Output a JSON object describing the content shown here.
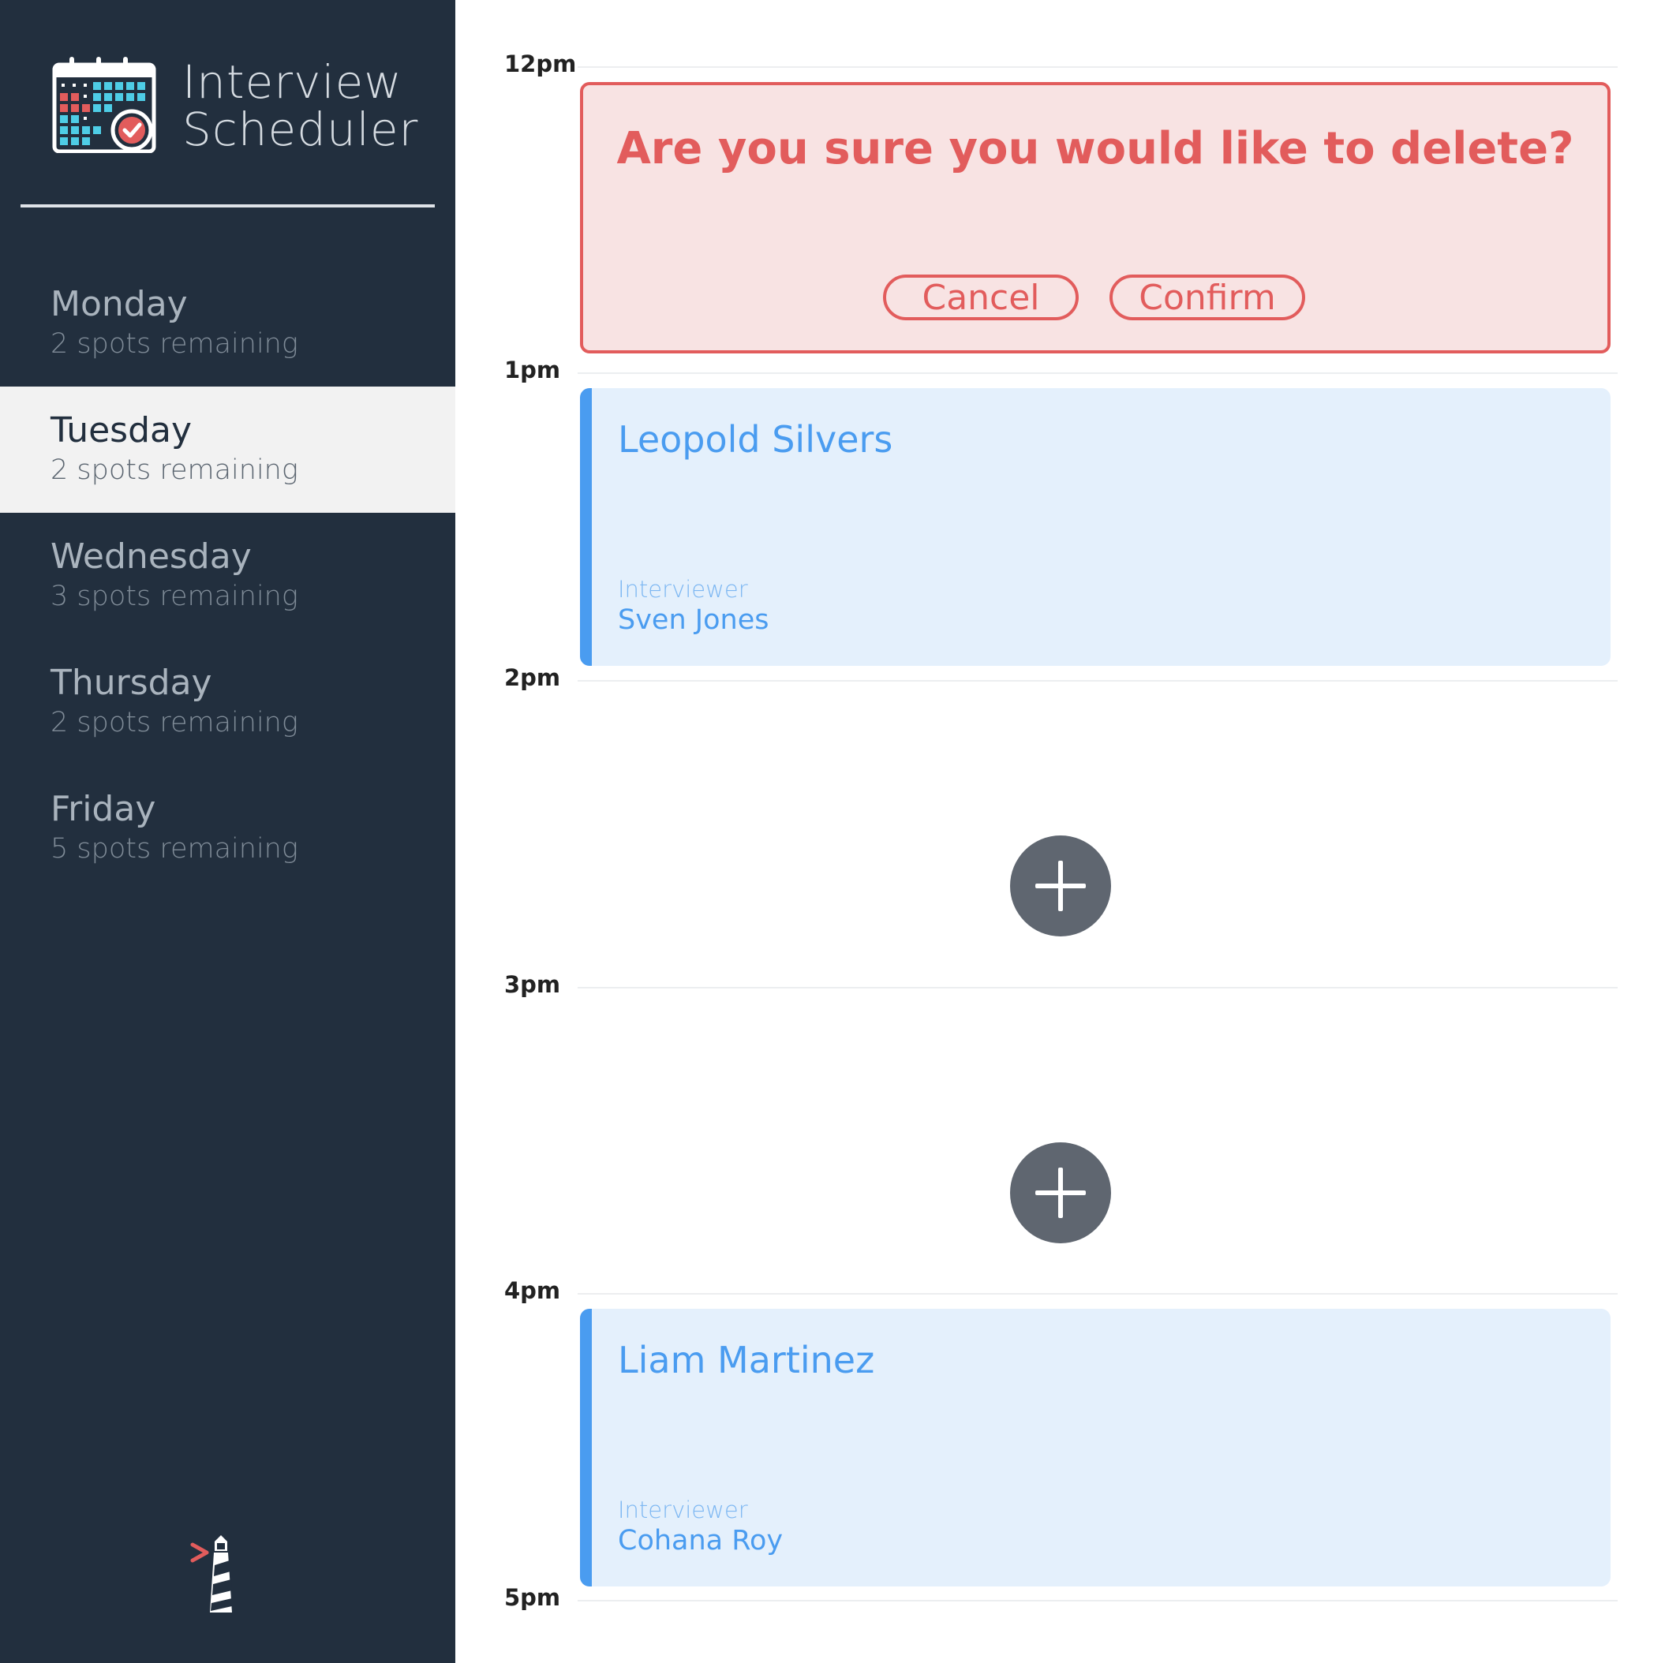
{
  "app": {
    "title_line1": "Interview",
    "title_line2": "Scheduler",
    "logo_icon": "calendar-check-icon",
    "footer_icon": "lighthouse-icon"
  },
  "sidebar": {
    "days": [
      {
        "name": "Monday",
        "spots": "2 spots remaining",
        "selected": false
      },
      {
        "name": "Tuesday",
        "spots": "2 spots remaining",
        "selected": true
      },
      {
        "name": "Wednesday",
        "spots": "3 spots remaining",
        "selected": false
      },
      {
        "name": "Thursday",
        "spots": "2 spots remaining",
        "selected": false
      },
      {
        "name": "Friday",
        "spots": "5 spots remaining",
        "selected": false
      }
    ]
  },
  "schedule": {
    "slots": [
      {
        "time": "12pm",
        "confirm": {
          "message": "Are you sure you would like to delete?",
          "cancel_label": "Cancel",
          "confirm_label": "Confirm"
        }
      },
      {
        "time": "1pm",
        "appointment": {
          "student": "Leopold Silvers",
          "interviewer_label": "Interviewer",
          "interviewer": "Sven Jones"
        }
      },
      {
        "time": "2pm",
        "add_icon": "plus-icon"
      },
      {
        "time": "3pm",
        "add_icon": "plus-icon"
      },
      {
        "time": "4pm",
        "appointment": {
          "student": "Liam Martinez",
          "interviewer_label": "Interviewer",
          "interviewer": "Cohana Roy"
        }
      },
      {
        "time": "5pm"
      }
    ]
  },
  "colors": {
    "sidebar_bg": "#222f3e",
    "selected_day_bg": "#f2f2f2",
    "danger": "#e25c5c",
    "danger_bg": "#f8e3e3",
    "appointment_accent": "#4a9cf0",
    "appointment_bg": "#e4f0fc",
    "add_button": "#5f6670"
  }
}
